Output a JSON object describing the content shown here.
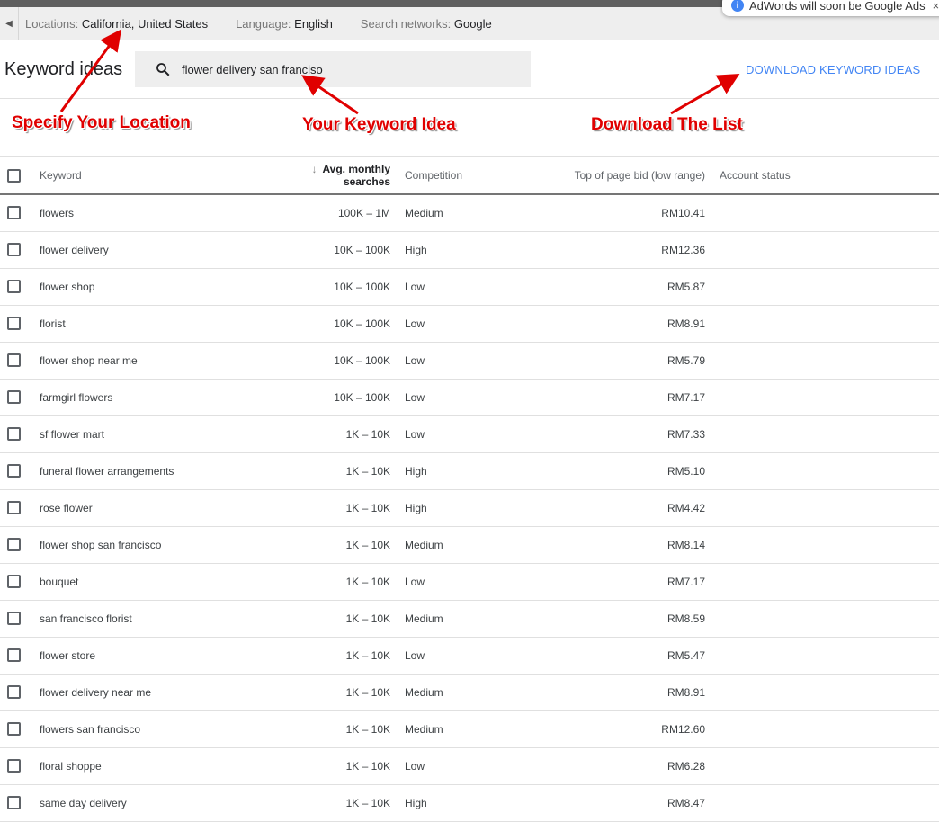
{
  "notification": {
    "text": "AdWords will soon be Google Ads",
    "close": "×"
  },
  "filters": [
    {
      "key": "Locations:",
      "value": "California, United States"
    },
    {
      "key": "Language:",
      "value": "English"
    },
    {
      "key": "Search networks:",
      "value": "Google"
    }
  ],
  "header": {
    "title": "Keyword ideas",
    "search_value": "flower delivery san franciso",
    "download_label": "DOWNLOAD KEYWORD IDEAS"
  },
  "annotations": {
    "location": "Specify Your Location",
    "keyword": "Your Keyword Idea",
    "download": "Download The List",
    "color": "#e00000"
  },
  "table": {
    "columns": [
      "Keyword",
      "Avg. monthly searches",
      "Competition",
      "Top of page bid (low range)",
      "Account status"
    ],
    "sort": "descending",
    "rows": [
      [
        "flowers",
        "100K – 1M",
        "Medium",
        "RM10.41"
      ],
      [
        "flower delivery",
        "10K – 100K",
        "High",
        "RM12.36"
      ],
      [
        "flower shop",
        "10K – 100K",
        "Low",
        "RM5.87"
      ],
      [
        "florist",
        "10K – 100K",
        "Low",
        "RM8.91"
      ],
      [
        "flower shop near me",
        "10K – 100K",
        "Low",
        "RM5.79"
      ],
      [
        "farmgirl flowers",
        "10K – 100K",
        "Low",
        "RM7.17"
      ],
      [
        "sf flower mart",
        "1K – 10K",
        "Low",
        "RM7.33"
      ],
      [
        "funeral flower arrangements",
        "1K – 10K",
        "High",
        "RM5.10"
      ],
      [
        "rose flower",
        "1K – 10K",
        "High",
        "RM4.42"
      ],
      [
        "flower shop san francisco",
        "1K – 10K",
        "Medium",
        "RM8.14"
      ],
      [
        "bouquet",
        "1K – 10K",
        "Low",
        "RM7.17"
      ],
      [
        "san francisco florist",
        "1K – 10K",
        "Medium",
        "RM8.59"
      ],
      [
        "flower store",
        "1K – 10K",
        "Low",
        "RM5.47"
      ],
      [
        "flower delivery near me",
        "1K – 10K",
        "Medium",
        "RM8.91"
      ],
      [
        "flowers san francisco",
        "1K – 10K",
        "Medium",
        "RM12.60"
      ],
      [
        "floral shoppe",
        "1K – 10K",
        "Low",
        "RM6.28"
      ],
      [
        "same day delivery",
        "1K – 10K",
        "High",
        "RM8.47"
      ]
    ]
  }
}
